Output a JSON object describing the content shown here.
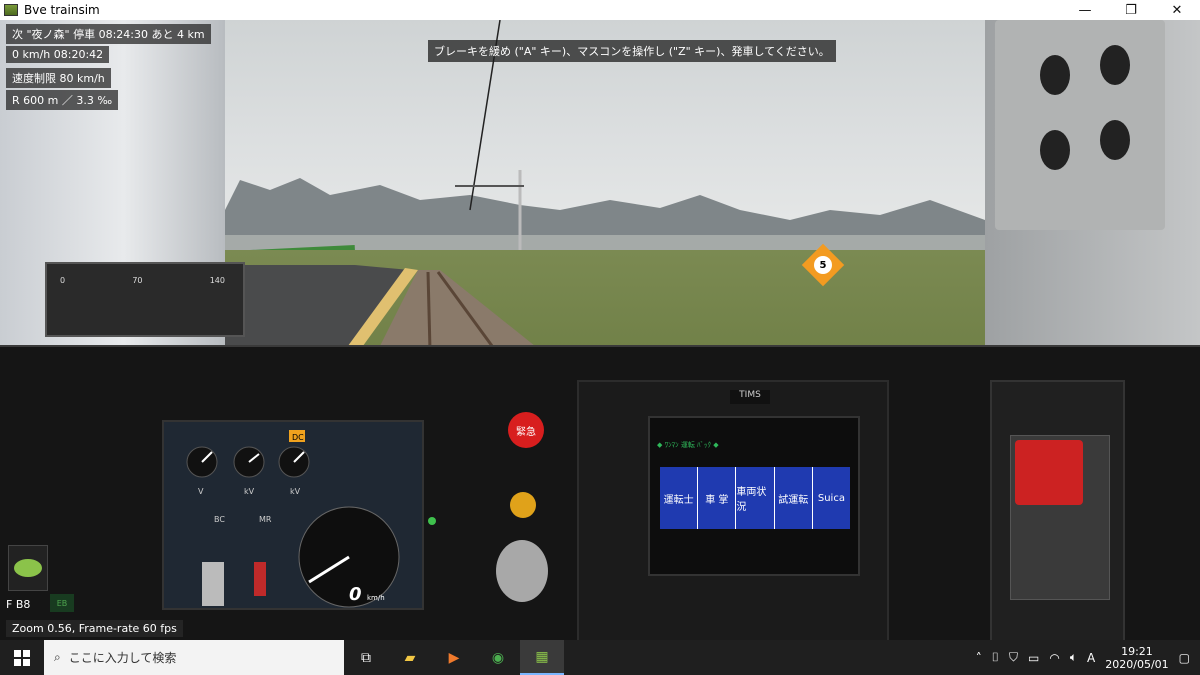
{
  "window": {
    "title": "Bve trainsim",
    "minimize_glyph": "—",
    "maximize_glyph": "❐",
    "close_glyph": "✕"
  },
  "hud": {
    "next_stop": "次 \"夜ノ森\" 停車 08:24:30 あと 4 km",
    "speed_time": "0 km/h  08:20:42",
    "speed_limit": "速度制限 80 km/h",
    "curve_grade": "R 600 m  ／ 3.3 ‰",
    "message": "ブレーキを緩め (\"A\" キー)、マスコンを操作し (\"Z\" キー)、発車してください。",
    "notch": "F  B8",
    "fb_indicator": "EB",
    "zoom_fps": "Zoom 0.56, Frame-rate 60 fps"
  },
  "meter": {
    "scale_min": "0",
    "scale_mid": "70",
    "scale_max": "140"
  },
  "speed_sign": {
    "value": "5"
  },
  "speed_panel": {
    "dc_label": "DC",
    "speed_readout": "0",
    "speed_unit": "km/h",
    "bc_label": "BC",
    "mr_label": "MR",
    "kv_label": "kV",
    "v_label": "V"
  },
  "emergency": {
    "label": "緊急"
  },
  "tims": {
    "label": "TIMS",
    "status": "◆ ﾜﾝﾏﾝ 運転 ﾊﾞｯｸ ◆",
    "menu": [
      "運転士",
      "車 掌",
      "車両状況",
      "試運転",
      "Suica"
    ]
  },
  "taskbar": {
    "search_placeholder": "ここに入力して検索",
    "ime": "A",
    "time": "19:21",
    "date": "2020/05/01"
  },
  "colors": {
    "tims_menu": "#1f3ab0",
    "emergency": "#d81e1e",
    "speed_sign": "#f39b21"
  }
}
